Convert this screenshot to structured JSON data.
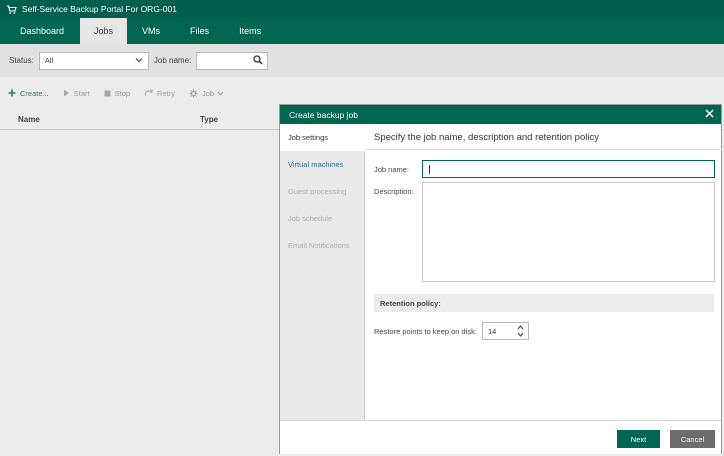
{
  "header": {
    "title": "Self-Service Backup Portal For ORG-001",
    "logo_icon": "veeam-cart-icon"
  },
  "nav": {
    "tabs": [
      "Dashboard",
      "Jobs",
      "VMs",
      "Files",
      "Items"
    ],
    "active": "Jobs"
  },
  "filters": {
    "status_label": "Status:",
    "status_value": "All",
    "jobname_label": "Job name:",
    "jobname_value": ""
  },
  "toolbar": {
    "create": "Create...",
    "start": "Start",
    "stop": "Stop",
    "retry": "Retry",
    "job": "Job"
  },
  "table": {
    "columns": [
      "Name",
      "Type"
    ]
  },
  "dialog": {
    "title": "Create backup job",
    "steps": [
      "Job settings",
      "Virtual machines",
      "Guest processing",
      "Job schedule",
      "Email Notifications"
    ],
    "heading": "Specify the job name, description and retention policy",
    "job_name_label": "Job name:",
    "job_name_value": "",
    "description_label": "Description:",
    "description_value": "",
    "retention_heading": "Retention policy:",
    "restore_points_label": "Restore points to keep on disk:",
    "restore_points_value": "14",
    "next": "Next",
    "cancel": "Cancel"
  },
  "colors": {
    "brand_green": "#00664f",
    "header_green": "#005f4b",
    "cancel_gray": "#6d6d6d",
    "link_blue": "#2a6f8f"
  }
}
